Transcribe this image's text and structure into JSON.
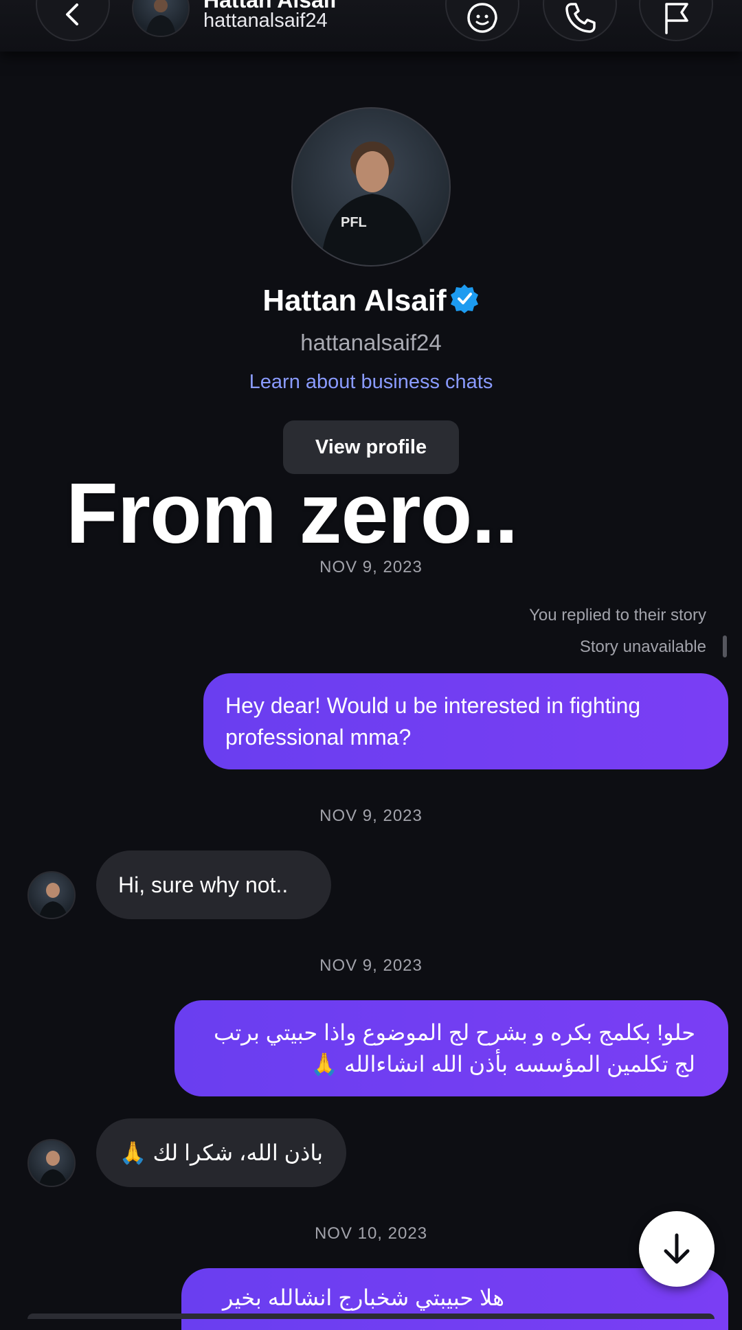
{
  "header": {
    "name_partial": "Hattan Alsaif",
    "username": "hattanalsaif24",
    "back_icon": "chevron-left-icon",
    "sticker_icon": "sticker-face-icon",
    "call_icon": "phone-icon",
    "report_icon": "flag-icon"
  },
  "profile": {
    "name": "Hattan Alsaif",
    "username": "hattanalsaif24",
    "business_link": "Learn about business chats",
    "view_profile": "View profile",
    "verified_color": "#1d9bf0"
  },
  "overlay_caption": "From zero..",
  "thread": {
    "date_1": "NOV 9, 2023",
    "story_reply_note": "You replied to their story",
    "story_status": "Story unavailable",
    "msg_1": "Hey dear! Would u be interested in fighting professional mma?",
    "date_2": "NOV 9, 2023",
    "msg_2": "Hi, sure why not..",
    "date_3": "NOV 9, 2023",
    "msg_3": "حلو! بكلمج بكره و بشرح لج الموضوع واذا حبيتي برتب لج تكلمين المؤسسه بأذن الله انشاءالله 🙏",
    "msg_4": "باذن الله، شكرا لك 🙏",
    "date_4": "NOV 10, 2023",
    "msg_5": "هلا حبيبتي  شخبارج انشالله بخير"
  },
  "colors": {
    "background": "#0d0e13",
    "outgoing_bubble": "#7040f2",
    "incoming_bubble": "#26272d",
    "link": "#8a9bff"
  }
}
